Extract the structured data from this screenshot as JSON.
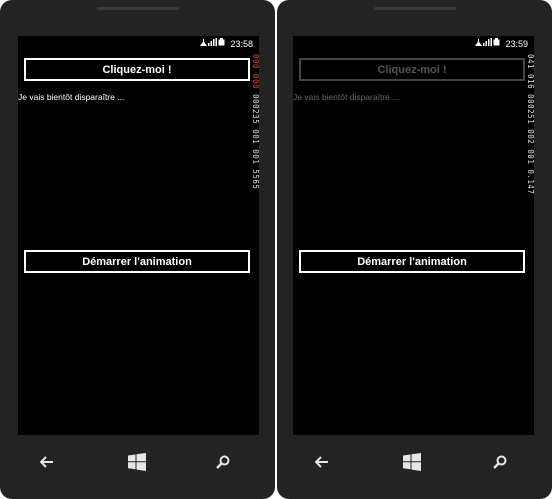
{
  "left_phone": {
    "clock": "23:58",
    "top_button_label": "Cliquez-moi !",
    "fade_text": "Je vais bientôt disparaître ...",
    "counter_red": "000 000 ",
    "counter_rest": "000235 001 001 5565",
    "animate_button_label": "Démarrer l'animation"
  },
  "right_phone": {
    "clock": "23:59",
    "top_button_label": "Cliquez-moi !",
    "fade_text": "Je vais bientôt disparaître ...",
    "counter": "041 016 000251 002 001 0.147",
    "animate_button_label": "Démarrer l'animation"
  },
  "nav_icons": [
    "back-arrow-icon",
    "windows-logo-icon",
    "search-icon"
  ],
  "colors": {
    "accent": "#e0452c",
    "screen": "#000000",
    "bezel": "#232323"
  }
}
